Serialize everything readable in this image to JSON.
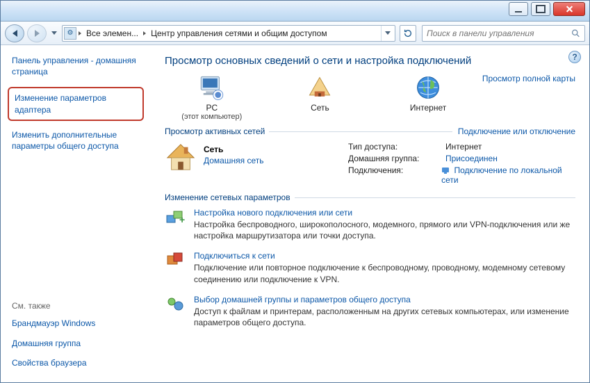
{
  "titlebar": {},
  "nav": {
    "breadcrumb_root_icon": "control-panel",
    "crumb1": "Все элемен...",
    "crumb2": "Центр управления сетями и общим доступом",
    "search_placeholder": "Поиск в панели управления"
  },
  "sidebar": {
    "home": "Панель управления - домашняя страница",
    "adapter": "Изменение параметров адаптера",
    "sharing": "Изменить дополнительные параметры общего доступа",
    "seealso_hdr": "См. также",
    "firewall": "Брандмауэр Windows",
    "homegroup": "Домашняя группа",
    "browser": "Свойства браузера"
  },
  "main": {
    "heading": "Просмотр основных сведений о сети и настройка подключений",
    "map": {
      "pc_name": "PC",
      "pc_sub": "(этот компьютер)",
      "net_name": "Сеть",
      "internet_name": "Интернет",
      "fullmap": "Просмотр полной карты"
    },
    "active_hdr": "Просмотр активных сетей",
    "active_link": "Подключение или отключение",
    "network": {
      "name": "Сеть",
      "type": "Домашняя сеть",
      "labels": {
        "access": "Тип доступа:",
        "homegroup": "Домашняя группа:",
        "conn": "Подключения:"
      },
      "values": {
        "access": "Интернет",
        "homegroup": "Присоединен",
        "conn": "Подключение по локальной сети"
      }
    },
    "change_hdr": "Изменение сетевых параметров",
    "tasks": [
      {
        "title": "Настройка нового подключения или сети",
        "desc": "Настройка беспроводного, широкополосного, модемного, прямого или VPN-подключения или же настройка маршрутизатора или точки доступа."
      },
      {
        "title": "Подключиться к сети",
        "desc": "Подключение или повторное подключение к беспроводному, проводному, модемному сетевому соединению или подключение к VPN."
      },
      {
        "title": "Выбор домашней группы и параметров общего доступа",
        "desc": "Доступ к файлам и принтерам, расположенным на других сетевых компьютерах, или изменение параметров общего доступа."
      }
    ]
  }
}
